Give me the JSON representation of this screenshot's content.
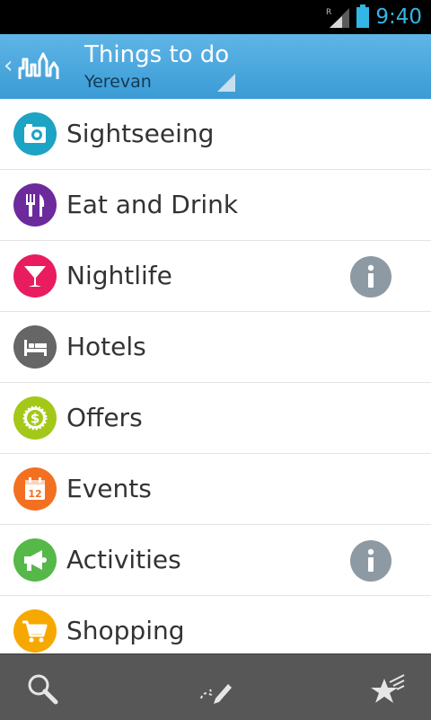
{
  "status_bar": {
    "time": "9:40",
    "network_label": "R"
  },
  "action_bar": {
    "title": "Things to do",
    "subtitle": "Yerevan",
    "up_icon": "chevron-left-icon",
    "logo_icon": "city-skyline-logo"
  },
  "categories": [
    {
      "label": "Sightseeing",
      "icon": "camera-icon",
      "color": "#1da3c4",
      "has_info": false
    },
    {
      "label": "Eat and Drink",
      "icon": "fork-knife-icon",
      "color": "#6c2a9c",
      "has_info": false
    },
    {
      "label": "Nightlife",
      "icon": "cocktail-icon",
      "color": "#e91c5f",
      "has_info": true
    },
    {
      "label": "Hotels",
      "icon": "bed-icon",
      "color": "#666666",
      "has_info": false
    },
    {
      "label": "Offers",
      "icon": "dollar-badge-icon",
      "color": "#a4c818",
      "has_info": false
    },
    {
      "label": "Events",
      "icon": "calendar-icon",
      "color": "#f37021",
      "has_info": false
    },
    {
      "label": "Activities",
      "icon": "megaphone-icon",
      "color": "#55b848",
      "has_info": true
    },
    {
      "label": "Shopping",
      "icon": "shopping-cart-icon",
      "color": "#f7a800",
      "has_info": false
    }
  ],
  "calendar_day": "12",
  "info_icon": "info-icon",
  "bottom_bar": [
    {
      "icon": "search-icon"
    },
    {
      "icon": "route-edit-icon"
    },
    {
      "icon": "star-icon"
    }
  ]
}
